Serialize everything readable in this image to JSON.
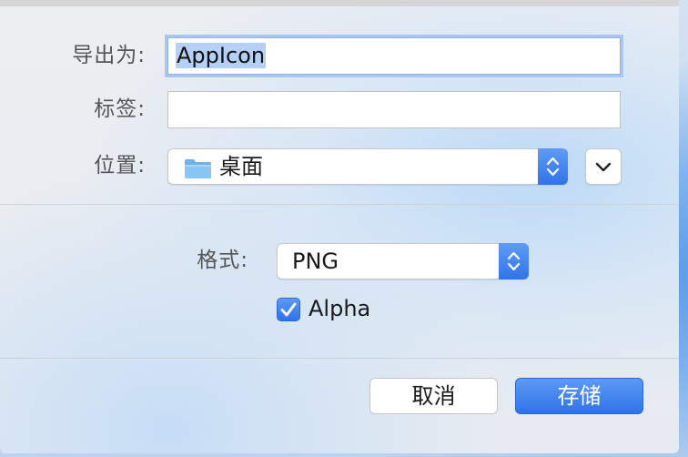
{
  "dialog": {
    "export_as_label": "导出为:",
    "export_as_value": "AppIcon",
    "tags_label": "标签:",
    "tags_value": "",
    "location_label": "位置:",
    "location_value": "桌面",
    "location_icon": "folder-icon",
    "format_label": "格式:",
    "format_value": "PNG",
    "alpha_label": "Alpha",
    "alpha_checked": true,
    "cancel_label": "取消",
    "save_label": "存储"
  },
  "colors": {
    "accent": "#2f73e9",
    "focus_ring": "#a9c7f1",
    "text_selection": "#b4d0f7"
  }
}
